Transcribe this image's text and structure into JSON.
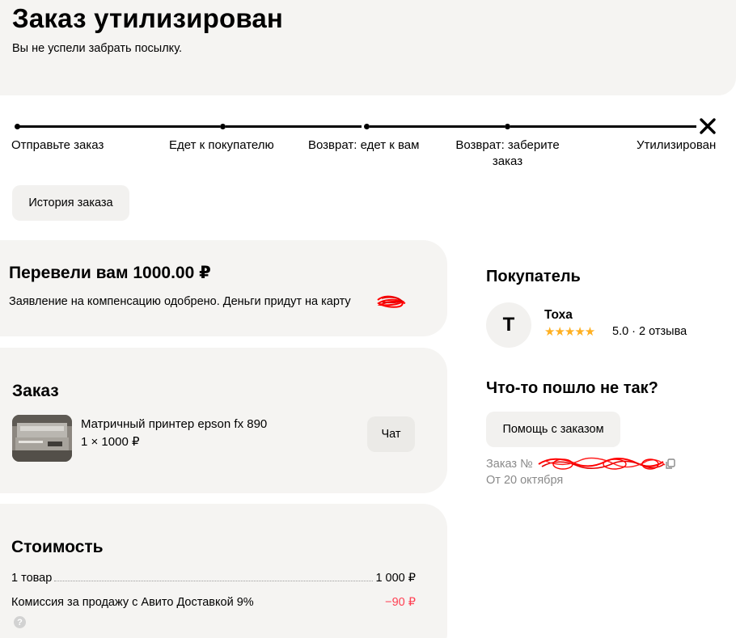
{
  "header": {
    "title": "Заказ утилизирован",
    "subtitle": "Вы не успели забрать посылку."
  },
  "stepper": {
    "steps": [
      {
        "label": "Отправьте заказ"
      },
      {
        "label": "Едет к покупателю"
      },
      {
        "label": "Возврат: едет к вам"
      },
      {
        "label": "Возврат: заберите заказ"
      },
      {
        "label": "Утилизирован"
      }
    ],
    "final_icon": "close-icon"
  },
  "history_button": {
    "label": "История заказа"
  },
  "refund": {
    "title": "Перевели вам 1000.00 ₽",
    "text": "Заявление на компенсацию одобрено. Деньги придут на карту"
  },
  "order": {
    "title": "Заказ",
    "product_name": "Матричный принтер epson fx 890",
    "product_qty_price": "1 × 1000 ₽",
    "chat_label": "Чат"
  },
  "cost": {
    "title": "Стоимость",
    "rows": [
      {
        "label": "1 товар",
        "value": "1 000 ₽"
      },
      {
        "label": "Комиссия за продажу с Авито Доставкой 9%",
        "value": "−90 ₽"
      }
    ],
    "colors": {
      "negative": "#ff4053"
    }
  },
  "buyer": {
    "title": "Покупатель",
    "initial": "Т",
    "name": "Тоха",
    "stars": "★★★★★",
    "rating_text": "5.0 · 2 отзыва"
  },
  "problem": {
    "title": "Что-то пошло не так?",
    "help_label": "Помощь с заказом",
    "order_number_label": "Заказ №",
    "date": "От 20 октября"
  },
  "colors": {
    "star": "#ffb021",
    "panel": "#f5f4f2",
    "scribble": "#ff0000"
  }
}
